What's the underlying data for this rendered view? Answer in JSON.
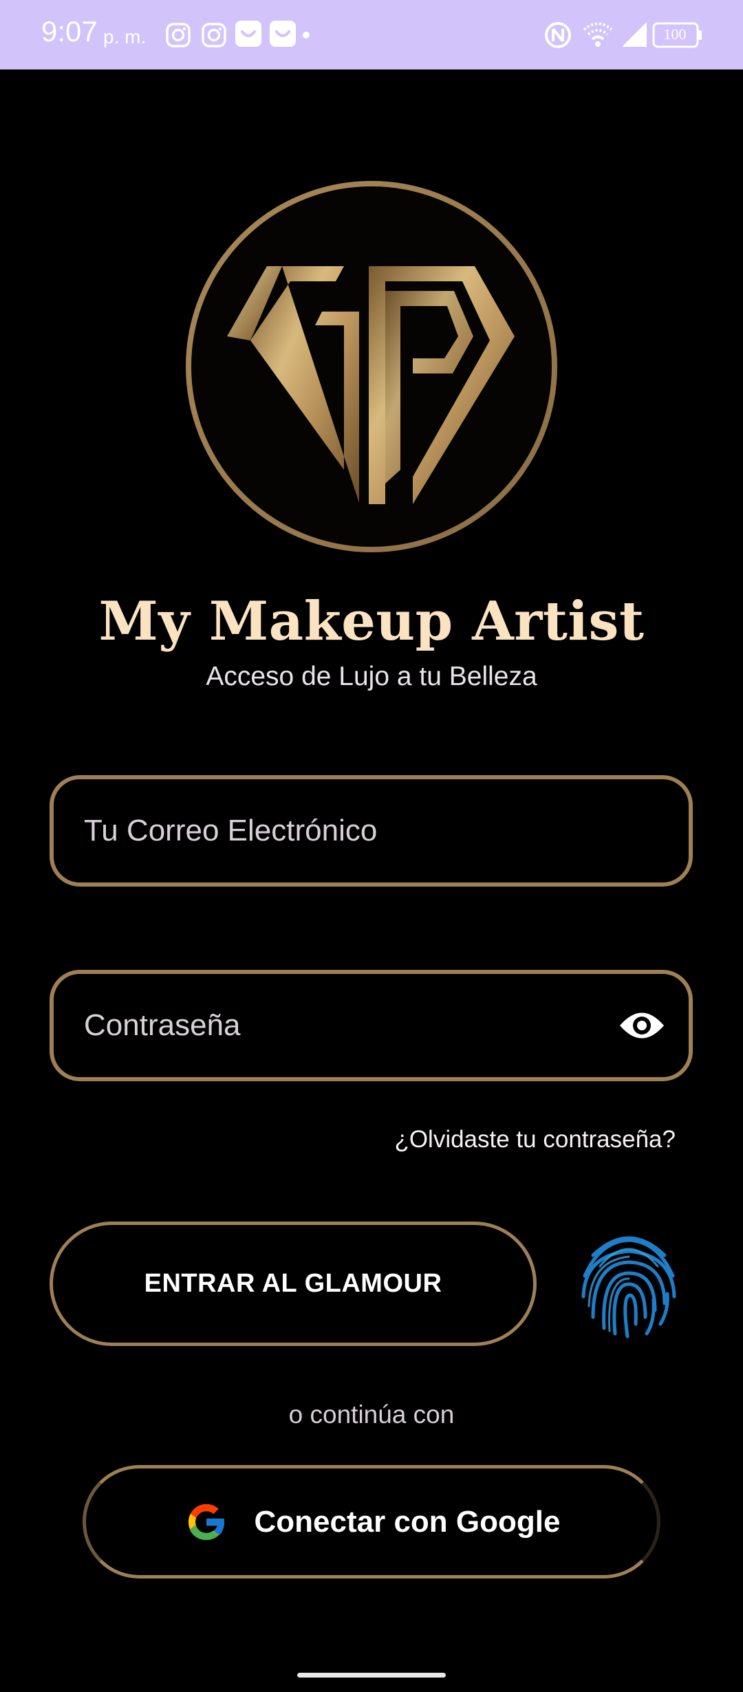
{
  "status_bar": {
    "time": "9:07",
    "ampm": "p. m.",
    "battery": "100",
    "background": "#d2c3fb",
    "left_icons": [
      "instagram-icon",
      "instagram-icon",
      "shopping-bag-icon",
      "shopping-bag-icon"
    ],
    "right_icons": [
      "nfc-icon",
      "wifi-icon",
      "signal-icon",
      "battery-icon"
    ]
  },
  "brand": {
    "logo": "GP diamond monogram",
    "title": "My Makeup Artist",
    "subtitle": "Acceso de Lujo a tu Belleza",
    "gold": "#9f8056",
    "title_color": "#fbe3c2"
  },
  "form": {
    "email_placeholder": "Tu Correo Electrónico",
    "email_value": "",
    "password_placeholder": "Contraseña",
    "password_value": "",
    "forgot_password": "¿Olvidaste tu contraseña?",
    "login_button": "ENTRAR AL GLAMOUR",
    "fingerprint_icon": "fingerprint-icon"
  },
  "alt_login": {
    "divider": "o continúa con",
    "google_button": "Conectar con Google",
    "google_icon": "google-icon"
  }
}
